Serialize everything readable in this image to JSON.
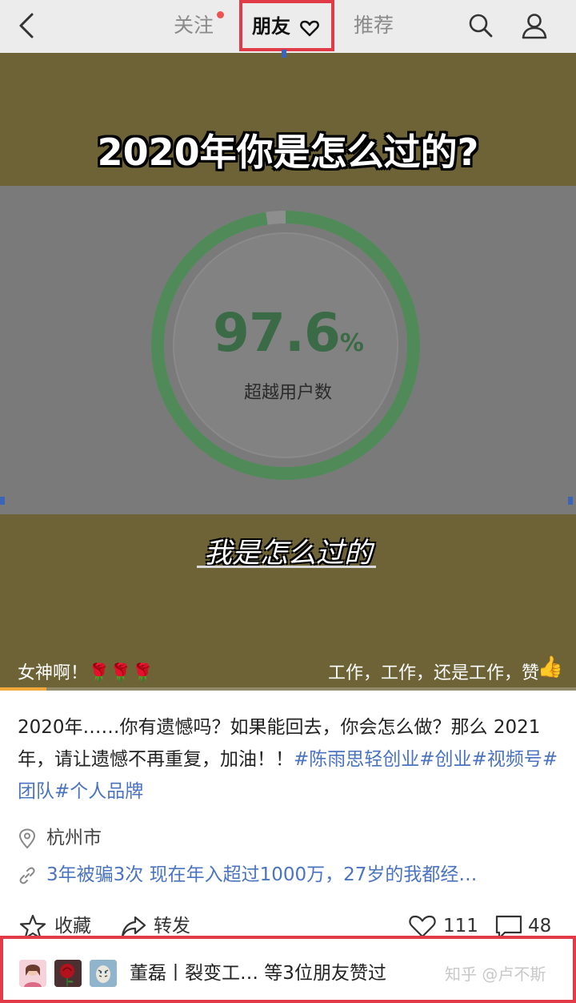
{
  "nav": {
    "tabs": [
      "关注",
      "朋友",
      "推荐"
    ]
  },
  "video": {
    "title": "2020年你是怎么过的?",
    "gauge_value": "97.6",
    "gauge_unit": "%",
    "gauge_label": "超越用户数",
    "gauge_progress": 0.976,
    "subtitle": "我是怎么过的",
    "caption_left": "女神啊！🌹🌹🌹",
    "caption_right": "工作，工作，还是工作，赞",
    "progress": 0.08
  },
  "post": {
    "text": "2020年……你有遗憾吗？如果能回去，你会怎么做？那么 2021年，请让遗憾不再重复，加油！！",
    "hashtags": "#陈雨思轻创业#创业#视频号#团队#个人品牌",
    "location": "杭州市",
    "link_text": "3年被骗3次 现在年入超过1000万，27岁的我都经…"
  },
  "actions": {
    "favorite_label": "收藏",
    "share_label": "转发",
    "like_count": "111",
    "comment_count": "48"
  },
  "liked_by": {
    "text": "董磊丨裂变工… 等3位朋友赞过",
    "watermark": "知乎 @卢不斯"
  },
  "colors": {
    "highlight_border": "#e23a46",
    "hashtag": "#4a73c2",
    "gauge_ring": "#4f8a58"
  }
}
